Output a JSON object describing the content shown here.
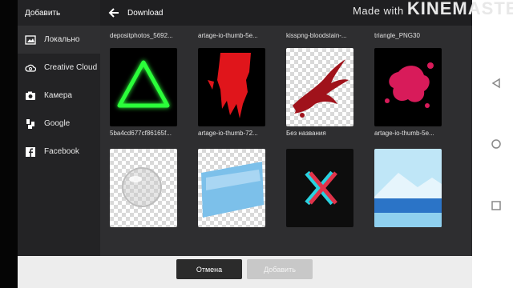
{
  "sidebar": {
    "title": "Добавить",
    "items": [
      {
        "label": "Локально",
        "icon": "image-icon"
      },
      {
        "label": "Creative Cloud",
        "icon": "creative-cloud-icon"
      },
      {
        "label": "Камера",
        "icon": "camera-icon"
      },
      {
        "label": "Google",
        "icon": "google-icon"
      },
      {
        "label": "Facebook",
        "icon": "facebook-icon"
      }
    ]
  },
  "topbar": {
    "title": "Download"
  },
  "grid": {
    "row0_names": [
      "depositphotos_5692...",
      "artage-io-thumb-5e...",
      "kisspng-bloodstain-...",
      "triangle_PNG30"
    ],
    "row1_names": [
      "5ba4cd677cf86165f...",
      "artage-io-thumb-72...",
      "Без названия",
      "artage-io-thumb-5e..."
    ]
  },
  "footer": {
    "cancel_label": "Отмена",
    "add_label": "Добавить"
  },
  "watermark": {
    "prefix": "Made with",
    "brand": "KINEMASTER"
  },
  "colors": {
    "accent_green": "#2bff3a",
    "accent_red": "#e0151b",
    "accent_pink": "#d81b5a",
    "cyan": "#29d2e0"
  }
}
